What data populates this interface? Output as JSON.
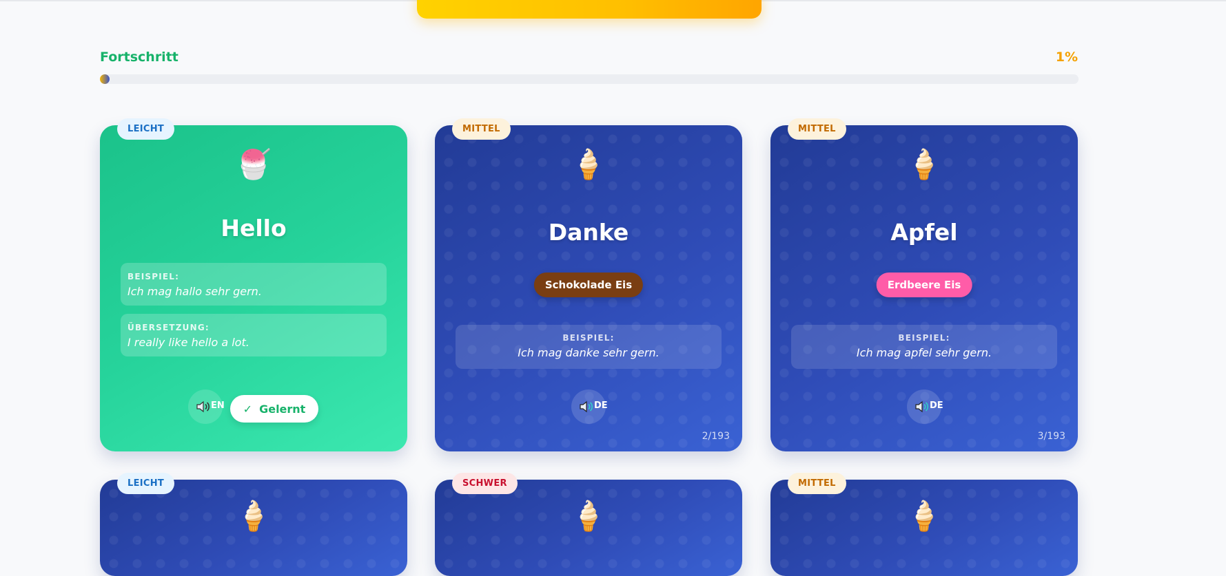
{
  "progress": {
    "label": "Fortschritt",
    "percent_text": "1%",
    "fraction": 0.01
  },
  "cards": [
    {
      "difficulty": "LEICHT",
      "icon": "shaved-ice-icon",
      "word": "Hello",
      "example_title": "BEISPIEL:",
      "example_text": "Ich mag hallo sehr gern.",
      "translation_title": "ÜBERSETZUNG:",
      "translation_text": "I really like hello a lot.",
      "audio_lang": "EN",
      "learned_label": "Gelernt",
      "learned_check": "✓"
    },
    {
      "difficulty": "MITTEL",
      "icon": "ice-cream-cone-icon",
      "word": "Danke",
      "flavor": "Schokolade Eis",
      "flavor_color": "#7a3e12",
      "example_title": "BEISPIEL:",
      "example_text": "Ich mag danke sehr gern.",
      "audio_lang": "DE",
      "counter": "2/193"
    },
    {
      "difficulty": "MITTEL",
      "icon": "ice-cream-cone-icon",
      "word": "Apfel",
      "flavor": "Erdbeere Eis",
      "flavor_color": "#ff5ca8",
      "example_title": "BEISPIEL:",
      "example_text": "Ich mag apfel sehr gern.",
      "audio_lang": "DE",
      "counter": "3/193"
    },
    {
      "difficulty": "LEICHT",
      "icon": "ice-cream-cone-icon"
    },
    {
      "difficulty": "SCHWER",
      "icon": "ice-cream-cone-icon"
    },
    {
      "difficulty": "MITTEL",
      "icon": "ice-cream-cone-icon"
    }
  ],
  "colors": {
    "accent_green": "#17b26a",
    "accent_orange": "#f4a100",
    "card_blue": "#2b48b4"
  }
}
